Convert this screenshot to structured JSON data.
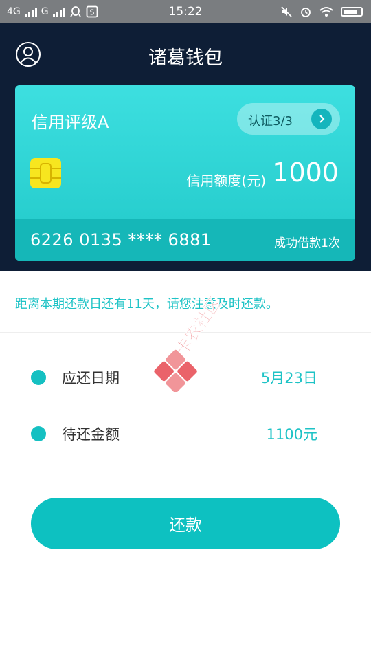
{
  "status_bar": {
    "network1": "4G",
    "network2": "G",
    "time": "15:22",
    "icons": [
      "signal-icon",
      "qq-icon",
      "s-notification-icon",
      "mute-icon",
      "alarm-icon",
      "wifi-icon",
      "battery-icon"
    ]
  },
  "header": {
    "title": "诸葛钱包",
    "avatar_icon": "user-avatar-icon"
  },
  "card": {
    "rating": "信用评级A",
    "verify_label": "认证3/3",
    "limit_label": "信用额度(元)",
    "limit_value": "1000",
    "card_number": "6226 0135 **** 6881",
    "loan_count": "成功借款1次"
  },
  "notice": {
    "text": "距离本期还款日还有11天，请您注意及时还款。"
  },
  "details": [
    {
      "label": "应还日期",
      "value": "5月23日"
    },
    {
      "label": "待还金额",
      "value": "1100元"
    }
  ],
  "actions": {
    "repay_label": "还款"
  },
  "watermark": {
    "text": "卡农社区"
  },
  "colors": {
    "header_bg": "#0e1e36",
    "accent": "#0dc1c1",
    "card_top": "#3ddfe0",
    "chip": "#f7e61f"
  }
}
